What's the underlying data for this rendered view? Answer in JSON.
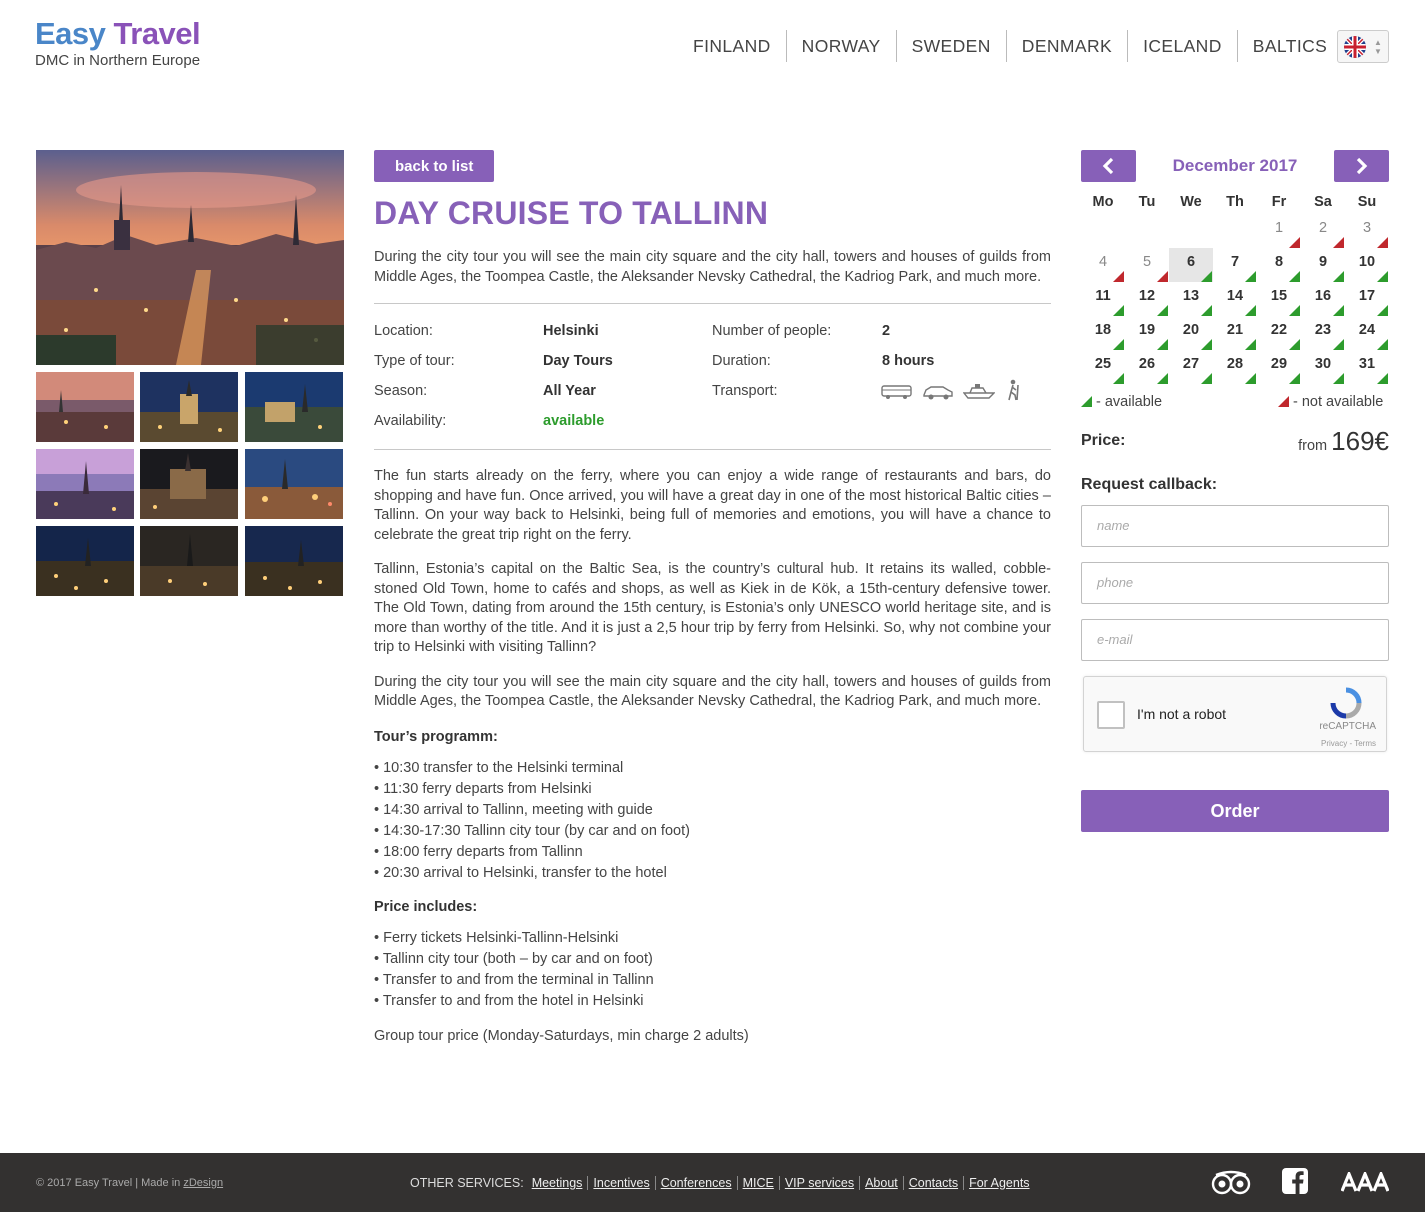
{
  "header": {
    "logo_easy": "Easy",
    "logo_travel": "Travel",
    "tagline": "DMC in Northern Europe",
    "nav": [
      "FINLAND",
      "NORWAY",
      "SWEDEN",
      "DENMARK",
      "ICELAND",
      "BALTICS"
    ],
    "language_icon": "uk-flag-icon"
  },
  "tour": {
    "back_label": "back to list",
    "title": "DAY CRUISE TO TALLINN",
    "intro": "During the city tour you will see the main city square and the city hall, towers and houses of guilds from Middle Ages, the Toompea Castle, the Aleksander Nevsky Cathedral, the Kadriog Park, and much more.",
    "details": {
      "location_label": "Location:",
      "location": "Helsinki",
      "type_label": "Type of tour:",
      "type": "Day Tours",
      "season_label": "Season:",
      "season": "All Year",
      "availability_label": "Availability:",
      "availability": "available",
      "people_label": "Number of people:",
      "people": "2",
      "duration_label": "Duration:",
      "duration": "8 hours",
      "transport_label": "Transport:",
      "transport_icons": [
        "bus-icon",
        "car-icon",
        "ship-icon",
        "hiker-icon"
      ]
    },
    "paragraphs": [
      "The fun starts already on the ferry, where you can enjoy a wide range of restaurants and bars, do shopping and have fun. Once arrived, you will have a great day in one of the most historical Baltic cities – Tallinn. On your way back to Helsinki, being full of memories and emotions, you will have a chance to celebrate the great trip right on the ferry.",
      "Tallinn, Estonia’s capital on the Baltic Sea, is the country’s cultural hub. It retains its walled, cobble-stoned Old Town, home to cafés and shops, as well as Kiek in de Kök, a 15th-century defensive tower. The Old Town, dating from around the 15th century, is Estonia’s only UNESCO world heritage site, and is more than worthy of the title. And it is just a 2,5 hour trip by ferry from Helsinki. So, why not combine your trip to Helsinki with visiting Tallinn?",
      "During the city tour you will see the main city square and the city hall, towers and houses of guilds from Middle Ages, the Toompea Castle, the Aleksander Nevsky Cathedral, the Kadriog Park, and much more."
    ],
    "programm_title": "Tour’s programm:",
    "programm": [
      "• 10:30 transfer to the Helsinki terminal",
      "• 11:30 ferry departs from Helsinki",
      "• 14:30 arrival to Tallinn, meeting with guide",
      "• 14:30-17:30 Tallinn city tour (by car and on foot)",
      "• 18:00 ferry departs from Tallinn",
      "• 20:30 arrival to Helsinki, transfer to the hotel"
    ],
    "includes_title": "Price includes:",
    "includes": [
      "• Ferry tickets Helsinki-Tallinn-Helsinki",
      "• Tallinn city tour (both – by car and on foot)",
      "• Transfer to and from the terminal in Tallinn",
      "• Transfer to and from the hotel in Helsinki"
    ],
    "group_note": "Group tour price (Monday-Saturdays, min charge 2 adults)"
  },
  "calendar": {
    "month": "December 2017",
    "weekdays": [
      "Mo",
      "Tu",
      "We",
      "Th",
      "Fr",
      "Sa",
      "Su"
    ],
    "days": [
      {
        "d": "1",
        "avail": false
      },
      {
        "d": "2",
        "avail": false
      },
      {
        "d": "3",
        "avail": false
      },
      {
        "d": "4",
        "avail": false
      },
      {
        "d": "5",
        "avail": false
      },
      {
        "d": "6",
        "avail": true,
        "today": true
      },
      {
        "d": "7",
        "avail": true
      },
      {
        "d": "8",
        "avail": true
      },
      {
        "d": "9",
        "avail": true
      },
      {
        "d": "10",
        "avail": true
      },
      {
        "d": "11",
        "avail": true
      },
      {
        "d": "12",
        "avail": true
      },
      {
        "d": "13",
        "avail": true
      },
      {
        "d": "14",
        "avail": true
      },
      {
        "d": "15",
        "avail": true
      },
      {
        "d": "16",
        "avail": true
      },
      {
        "d": "17",
        "avail": true
      },
      {
        "d": "18",
        "avail": true
      },
      {
        "d": "19",
        "avail": true
      },
      {
        "d": "20",
        "avail": true
      },
      {
        "d": "21",
        "avail": true
      },
      {
        "d": "22",
        "avail": true
      },
      {
        "d": "23",
        "avail": true
      },
      {
        "d": "24",
        "avail": true
      },
      {
        "d": "25",
        "avail": true
      },
      {
        "d": "26",
        "avail": true
      },
      {
        "d": "27",
        "avail": true
      },
      {
        "d": "28",
        "avail": true
      },
      {
        "d": "29",
        "avail": true
      },
      {
        "d": "30",
        "avail": true
      },
      {
        "d": "31",
        "avail": true
      }
    ],
    "legend_available": "- available",
    "legend_not_available": "- not available",
    "colors": {
      "available": "#2d9c2d",
      "not_available": "#c0282d",
      "accent": "#8760b8"
    }
  },
  "booking": {
    "price_label": "Price:",
    "price_from": "from",
    "price_value": "169€",
    "callback_label": "Request callback:",
    "name_placeholder": "name",
    "phone_placeholder": "phone",
    "email_placeholder": "e-mail",
    "captcha_label": "I'm not a robot",
    "captcha_brand": "reCAPTCHA",
    "captcha_terms": "Privacy - Terms",
    "order_label": "Order"
  },
  "footer": {
    "copyright": "© 2017 Easy Travel | Made in",
    "made_in_link": "zDesign",
    "services_label": "OTHER SERVICES:",
    "links": [
      "Meetings",
      "Incentives",
      "Conferences",
      "MICE",
      "VIP services",
      "About",
      "Contacts",
      "For Agents"
    ],
    "icons": [
      "tripadvisor-icon",
      "facebook-icon",
      "aaa-icon"
    ]
  }
}
